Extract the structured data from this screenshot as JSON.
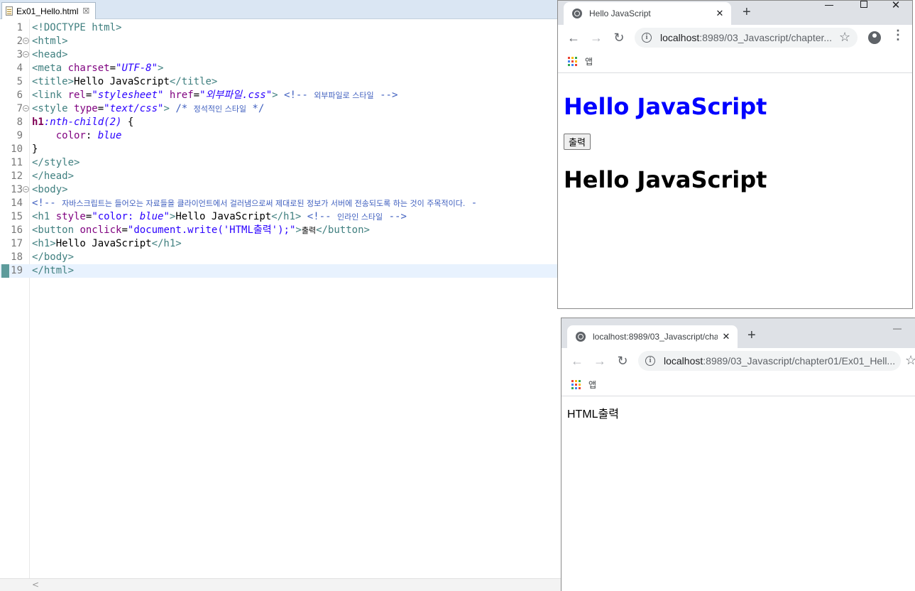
{
  "editor": {
    "tab_label": "Ex01_Hello.html",
    "tab_close": "☒",
    "current_line": 19,
    "lines": [
      {
        "n": "1",
        "fold": false,
        "parts": [
          [
            "tg",
            "<!DOCTYPE html>"
          ]
        ]
      },
      {
        "n": "2",
        "fold": true,
        "parts": [
          [
            "tg",
            "<html>"
          ]
        ]
      },
      {
        "n": "3",
        "fold": true,
        "parts": [
          [
            "tg",
            "<head>"
          ]
        ]
      },
      {
        "n": "4",
        "fold": false,
        "parts": [
          [
            "tg",
            "<meta "
          ],
          [
            "at",
            "charset"
          ],
          [
            "tx",
            "="
          ],
          [
            "av",
            "\"UTF-8\""
          ],
          [
            "tg",
            ">"
          ]
        ]
      },
      {
        "n": "5",
        "fold": false,
        "parts": [
          [
            "tg",
            "<title>"
          ],
          [
            "tx",
            "Hello JavaScript"
          ],
          [
            "tg",
            "</title>"
          ]
        ]
      },
      {
        "n": "6",
        "fold": false,
        "parts": [
          [
            "tg",
            "<link "
          ],
          [
            "at",
            "rel"
          ],
          [
            "tx",
            "="
          ],
          [
            "av",
            "\"stylesheet\""
          ],
          [
            "tx",
            " "
          ],
          [
            "at",
            "href"
          ],
          [
            "tx",
            "="
          ],
          [
            "av",
            "\"외부파일.css\""
          ],
          [
            "tg",
            ">"
          ],
          [
            "tx",
            " "
          ],
          [
            "cm",
            "<!-- "
          ],
          [
            "cm ko",
            "외부파일로 스타일"
          ],
          [
            "cm",
            " -->"
          ]
        ]
      },
      {
        "n": "7",
        "fold": true,
        "parts": [
          [
            "tg",
            "<style "
          ],
          [
            "at",
            "type"
          ],
          [
            "tx",
            "="
          ],
          [
            "av",
            "\"text/css\""
          ],
          [
            "tg",
            ">"
          ],
          [
            "tx",
            " "
          ],
          [
            "cm",
            "/* "
          ],
          [
            "cm ko",
            "정석적인 스타일"
          ],
          [
            "cm",
            " */"
          ]
        ]
      },
      {
        "n": "8",
        "fold": false,
        "parts": [
          [
            "kw",
            "h1"
          ],
          [
            "av",
            ":nth-child(2)"
          ],
          [
            "tx",
            " {"
          ]
        ]
      },
      {
        "n": "9",
        "fold": false,
        "parts": [
          [
            "tx",
            "    "
          ],
          [
            "at",
            "color"
          ],
          [
            "tx",
            ": "
          ],
          [
            "av",
            "blue"
          ]
        ]
      },
      {
        "n": "10",
        "fold": false,
        "parts": [
          [
            "tx",
            "}"
          ]
        ]
      },
      {
        "n": "11",
        "fold": false,
        "parts": [
          [
            "tg",
            "</style>"
          ]
        ]
      },
      {
        "n": "12",
        "fold": false,
        "parts": [
          [
            "tg",
            "</head>"
          ]
        ]
      },
      {
        "n": "13",
        "fold": true,
        "parts": [
          [
            "tg",
            "<body>"
          ]
        ]
      },
      {
        "n": "14",
        "fold": false,
        "parts": [
          [
            "cm",
            "<!-- "
          ],
          [
            "cm ko",
            "자바스크립트는 들어오는 자료들을 클라이언트에서 걸러냄으로써 제대로된 정보가 서버에 전송되도록 하는 것이 주목적이다."
          ],
          [
            "cm",
            " -"
          ]
        ]
      },
      {
        "n": "15",
        "fold": false,
        "parts": [
          [
            "tg",
            "<h1 "
          ],
          [
            "at",
            "style"
          ],
          [
            "tx",
            "="
          ],
          [
            "sv",
            "\"color: "
          ],
          [
            "av",
            "blue"
          ],
          [
            "sv",
            "\""
          ],
          [
            "tg",
            ">"
          ],
          [
            "tx",
            "Hello JavaScript"
          ],
          [
            "tg",
            "</h1>"
          ],
          [
            "tx",
            " "
          ],
          [
            "cm",
            "<!-- "
          ],
          [
            "cm ko",
            "인라인 스타일"
          ],
          [
            "cm",
            " -->"
          ]
        ]
      },
      {
        "n": "16",
        "fold": false,
        "parts": [
          [
            "tg",
            "<button "
          ],
          [
            "at",
            "onclick"
          ],
          [
            "tx",
            "="
          ],
          [
            "sv",
            "\"document.write('HTML출력');\""
          ],
          [
            "tg",
            ">"
          ],
          [
            "tx ko",
            "출력"
          ],
          [
            "tg",
            "</button>"
          ]
        ]
      },
      {
        "n": "17",
        "fold": false,
        "parts": [
          [
            "tg",
            "<h1>"
          ],
          [
            "tx",
            "Hello JavaScript"
          ],
          [
            "tg",
            "</h1>"
          ]
        ]
      },
      {
        "n": "18",
        "fold": false,
        "parts": [
          [
            "tg",
            "</body>"
          ]
        ]
      },
      {
        "n": "19",
        "fold": false,
        "parts": [
          [
            "tg",
            "</html>"
          ]
        ]
      }
    ],
    "scroll_left": "<"
  },
  "browser1": {
    "tab_title": "Hello JavaScript",
    "tab_close": "✕",
    "new_tab": "+",
    "win_close": "✕",
    "back": "←",
    "forward": "→",
    "reload": "↻",
    "url_host": "localhost",
    "url_path": ":8989/03_Javascript/chapter...",
    "star": "☆",
    "menu": "⋮",
    "bookmark_apps": "앱",
    "page": {
      "h1_inline": "Hello JavaScript",
      "button_label": "출력",
      "h1_second": "Hello JavaScript"
    }
  },
  "browser2": {
    "tab_title": "localhost:8989/03_Javascript/cha",
    "tab_close": "✕",
    "new_tab": "+",
    "win_min": "—",
    "back": "←",
    "forward": "→",
    "reload": "↻",
    "url_host": "localhost",
    "url_path": ":8989/03_Javascript/chapter01/Ex01_Hell...",
    "star": "☆",
    "bookmark_apps": "앱",
    "page": {
      "output": "HTML출력"
    }
  },
  "colors": {
    "apps_grid": [
      "#ea4335",
      "#fbbc04",
      "#34a853",
      "#4285f4",
      "#ea4335",
      "#fbbc04",
      "#34a853",
      "#4285f4",
      "#ea4335"
    ]
  }
}
